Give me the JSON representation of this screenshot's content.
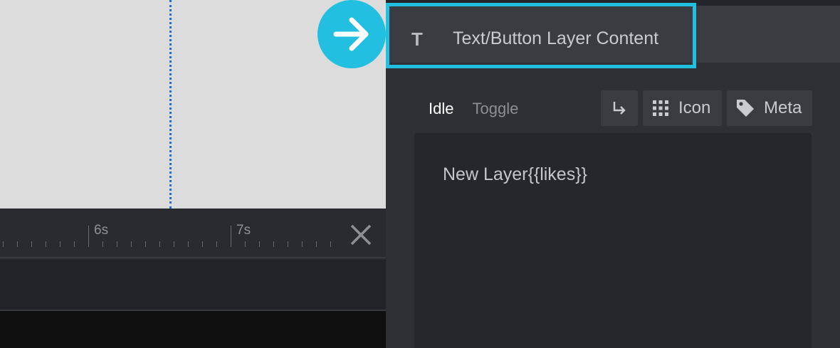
{
  "colors": {
    "accent": "#22bfe0",
    "guide_line": "#1f6fd6",
    "canvas_bg": "#dcdcdc",
    "panel_bg": "#2f3034"
  },
  "timeline": {
    "labels": [
      "6s",
      "7s"
    ],
    "close_icon": "close-icon"
  },
  "panel": {
    "header_icon": "T",
    "header_title": "Text/Button Layer Content",
    "tabs": [
      {
        "label": "Idle",
        "active": true
      },
      {
        "label": "Toggle",
        "active": false
      }
    ],
    "toolbar": {
      "enter_icon": "return-arrow-icon",
      "icon_label": "Icon",
      "meta_label": "Meta"
    },
    "editor_text": "New Layer{{likes}}"
  },
  "badge_icon": "arrow-right-icon"
}
